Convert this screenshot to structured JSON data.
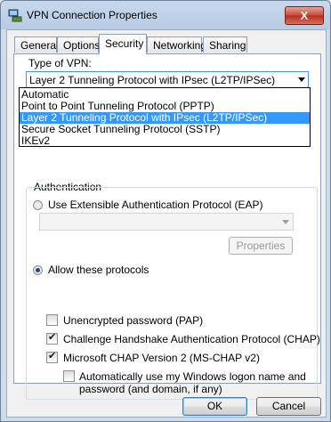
{
  "window": {
    "title": "VPN Connection Properties",
    "close_symbol": "X"
  },
  "tabs": [
    "General",
    "Options",
    "Security",
    "Networking",
    "Sharing"
  ],
  "active_tab": "Security",
  "vpn_type": {
    "label": "Type of VPN:",
    "selected": "Layer 2 Tunneling Protocol with IPsec (L2TP/IPSec)",
    "options": [
      "Automatic",
      "Point to Point Tunneling Protocol (PPTP)",
      "Layer 2 Tunneling Protocol with IPsec (L2TP/IPSec)",
      "Secure Socket Tunneling Protocol (SSTP)",
      "IKEv2"
    ],
    "highlighted_index": 2
  },
  "authentication": {
    "title": "Authentication",
    "eap_label": "Use Extensible Authentication Protocol (EAP)",
    "eap_selected": false,
    "properties_label": "Properties",
    "allow_label": "Allow these protocols",
    "allow_selected": true,
    "protocols": [
      {
        "label": "Unencrypted password (PAP)",
        "checked": false
      },
      {
        "label": "Challenge Handshake Authentication Protocol (CHAP)",
        "checked": true
      },
      {
        "label": "Microsoft CHAP Version 2 (MS-CHAP v2)",
        "checked": true
      }
    ],
    "auto_logon_line1": "Automatically use my Windows logon name and",
    "auto_logon_line2": "password (and domain, if any)",
    "auto_logon_checked": false
  },
  "buttons": {
    "ok": "OK",
    "cancel": "Cancel"
  },
  "icons": {
    "title": "network-connection-icon"
  },
  "colors": {
    "highlight": "#3399ff",
    "close": "#c7483a"
  }
}
